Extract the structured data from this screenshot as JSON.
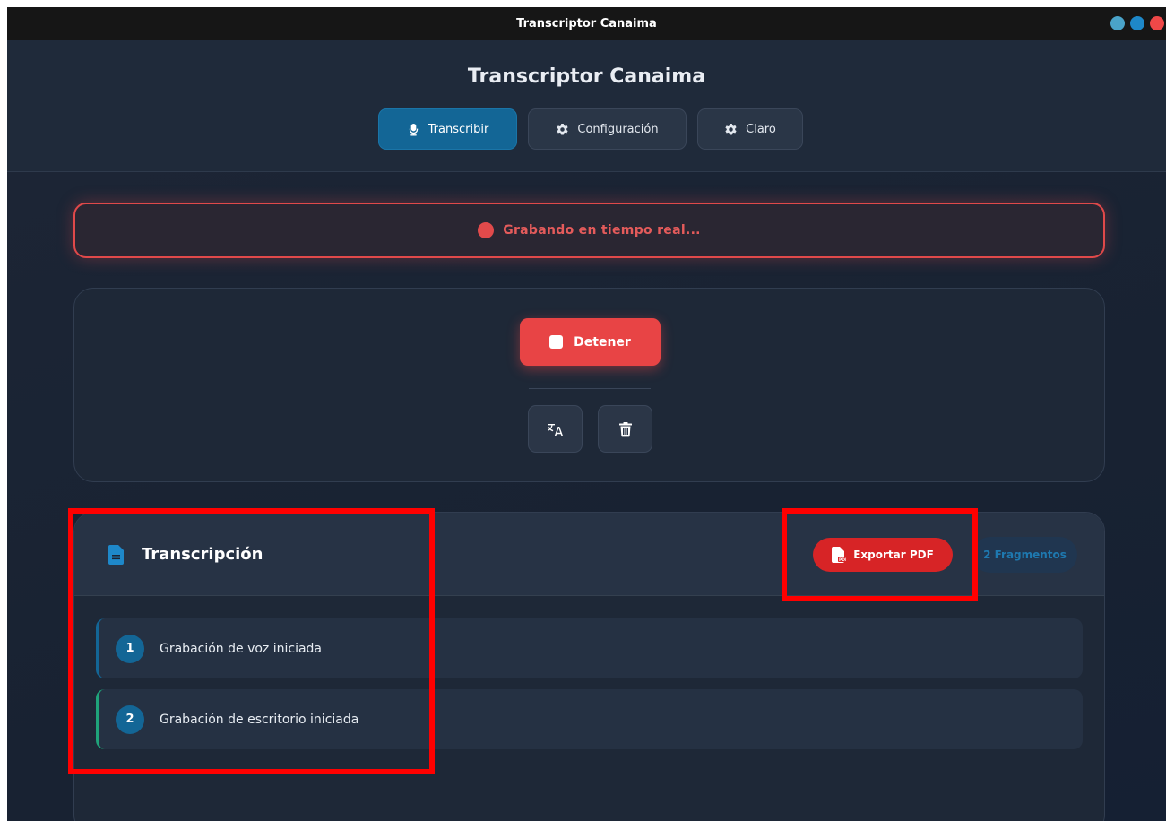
{
  "window": {
    "title": "Transcriptor Canaima",
    "controls": [
      {
        "name": "minimize",
        "color": "#4aa3c9"
      },
      {
        "name": "maximize",
        "color": "#1e88c9"
      },
      {
        "name": "close",
        "color": "#ef4848"
      }
    ]
  },
  "header": {
    "title": "Transcriptor Canaima",
    "nav": [
      {
        "label": "Transcribir",
        "icon": "microphone-icon",
        "active": true
      },
      {
        "label": "Configuración",
        "icon": "gear-icon",
        "active": false
      },
      {
        "label": "Claro",
        "icon": "gear-icon",
        "active": false
      }
    ]
  },
  "status": {
    "text": "Grabando en tiempo real...",
    "color": "#e14a4b"
  },
  "controls": {
    "stop_label": "Detener",
    "translate_icon": "translate-icon",
    "delete_icon": "trash-icon"
  },
  "transcript": {
    "title": "Transcripción",
    "title_icon": "document-icon",
    "export_label": "Exportar PDF",
    "export_icon": "pdf-file-icon",
    "fragments_label": "2 Fragmentos",
    "entries": [
      {
        "number": "1",
        "text": "Grabación de voz iniciada",
        "accent": "#136696"
      },
      {
        "number": "2",
        "text": "Grabación de escritorio iniciada",
        "accent": "#1fa37a"
      }
    ]
  },
  "colors": {
    "accent": "#136696",
    "danger": "#e84445",
    "background": "#1b2333",
    "highlight_box": "#ff0000"
  }
}
